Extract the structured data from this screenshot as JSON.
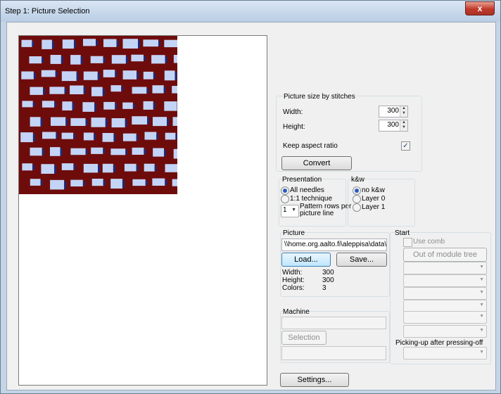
{
  "window": {
    "title": "Step 1: Picture Selection",
    "close_glyph": "x"
  },
  "picture_size": {
    "group_label": "Picture size by stitches",
    "width_label": "Width:",
    "width_value": "300",
    "height_label": "Height:",
    "height_value": "300",
    "keep_aspect_label": "Keep aspect ratio",
    "keep_aspect_checked": true,
    "convert_label": "Convert"
  },
  "presentation": {
    "group_label": "Presentation",
    "all_needles": "All needles",
    "one_to_one": "1:1 technique",
    "rows_value": "1",
    "rows_label_1": "Pattern rows per",
    "rows_label_2": "picture line"
  },
  "kw": {
    "group_label": "k&w",
    "no_kw": "no k&w",
    "layer0": "Layer 0",
    "layer1": "Layer 1"
  },
  "picture": {
    "group_label": "Picture",
    "path": "\\\\home.org.aalto.fi\\aleppisa\\data\\Deskt",
    "load_label": "Load...",
    "save_label": "Save...",
    "width_label": "Width:",
    "width_value": "300",
    "height_label": "Height:",
    "height_value": "300",
    "colors_label": "Colors:",
    "colors_value": "3"
  },
  "machine": {
    "group_label": "Machine",
    "selection_label": "Selection"
  },
  "start": {
    "group_label": "Start",
    "use_comb_label": "Use comb",
    "out_of_module_tree_label": "Out of module tree",
    "picking_up_label": "Picking-up after pressing-off"
  },
  "settings_label": "Settings...",
  "colors": {
    "pattern_dark": "#6e0c0c",
    "pattern_light": "#c4d4f6",
    "pattern_navy": "#1c2a7a"
  }
}
